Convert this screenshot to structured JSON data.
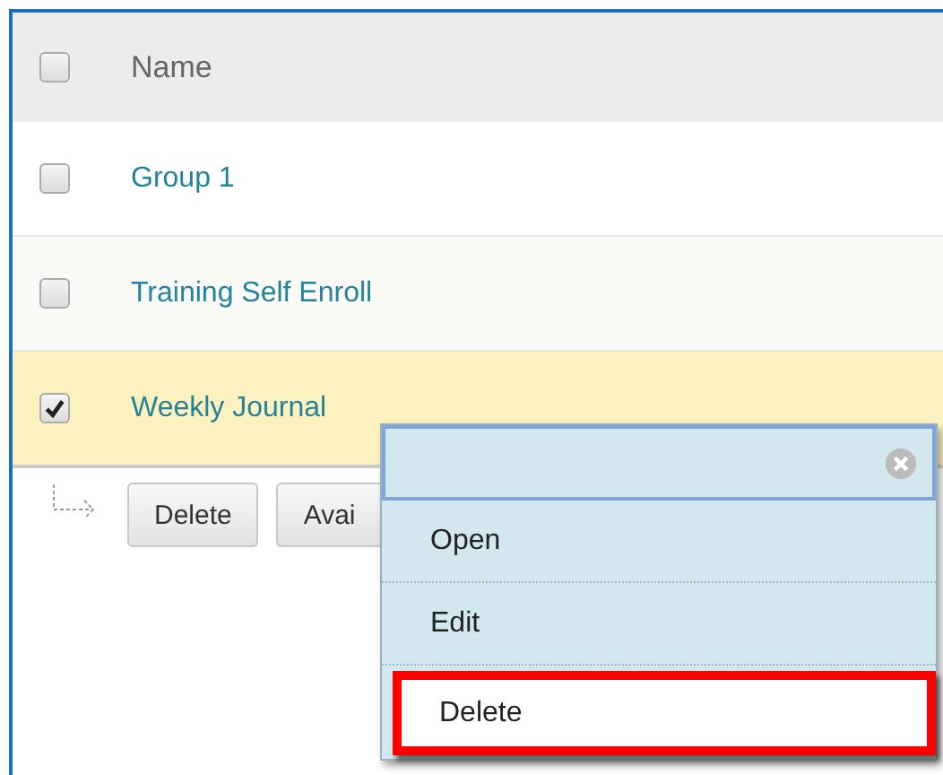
{
  "table": {
    "header": {
      "label": "Name",
      "checked": false
    },
    "rows": [
      {
        "name": "Group 1",
        "checked": false
      },
      {
        "name": "Training Self Enroll",
        "checked": false
      },
      {
        "name": "Weekly Journal",
        "checked": true
      }
    ]
  },
  "action_bar": {
    "buttons": [
      "Delete",
      "Avai"
    ]
  },
  "context_menu": {
    "items": [
      {
        "label": "Open",
        "highlighted": false
      },
      {
        "label": "Edit",
        "highlighted": false
      },
      {
        "label": "Delete",
        "highlighted": true
      }
    ]
  }
}
